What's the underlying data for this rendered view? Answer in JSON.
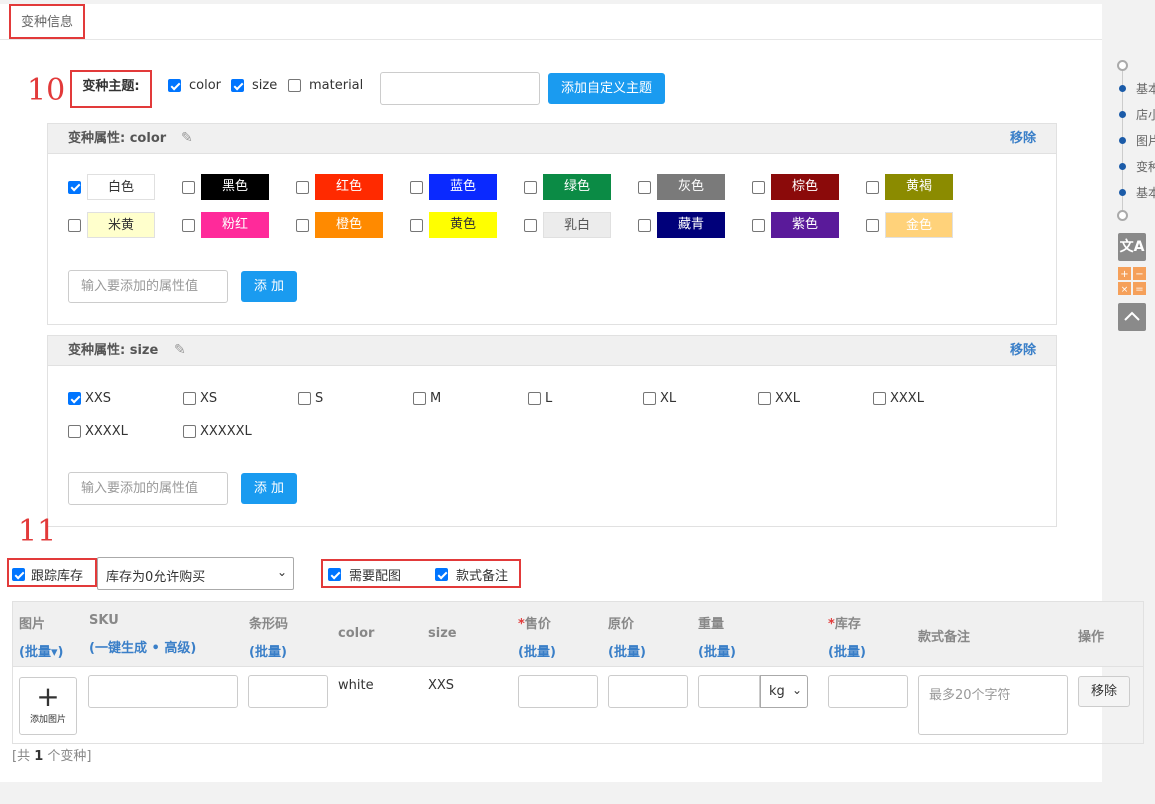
{
  "panel": {
    "title": "变种信息"
  },
  "annotations": {
    "step10": "10",
    "step11": "11"
  },
  "theme": {
    "label": "变种主题:",
    "options": [
      {
        "label": "color",
        "checked": true
      },
      {
        "label": "size",
        "checked": true
      },
      {
        "label": "material",
        "checked": false
      }
    ],
    "custom_input_value": "",
    "add_custom_button": "添加自定义主题"
  },
  "color_attr": {
    "title": "变种属性:  color",
    "remove": "移除",
    "items": [
      {
        "label": "白色",
        "checked": true,
        "bg": "#ffffff",
        "fg": "#333333"
      },
      {
        "label": "黑色",
        "checked": false,
        "bg": "#000000",
        "fg": "#ffffff"
      },
      {
        "label": "红色",
        "checked": false,
        "bg": "#ff2a00",
        "fg": "#ffffff"
      },
      {
        "label": "蓝色",
        "checked": false,
        "bg": "#0a29ff",
        "fg": "#ffffff"
      },
      {
        "label": "绿色",
        "checked": false,
        "bg": "#0b8b45",
        "fg": "#ffffff"
      },
      {
        "label": "灰色",
        "checked": false,
        "bg": "#7a7a7a",
        "fg": "#ffffff"
      },
      {
        "label": "棕色",
        "checked": false,
        "bg": "#8b0a0a",
        "fg": "#ffffff"
      },
      {
        "label": "黄褐",
        "checked": false,
        "bg": "#8b8b00",
        "fg": "#ffffff"
      },
      {
        "label": "米黄",
        "checked": false,
        "bg": "#ffffcc",
        "fg": "#333333"
      },
      {
        "label": "粉红",
        "checked": false,
        "bg": "#ff2a9a",
        "fg": "#ffffff"
      },
      {
        "label": "橙色",
        "checked": false,
        "bg": "#ff8a00",
        "fg": "#ffffff"
      },
      {
        "label": "黄色",
        "checked": false,
        "bg": "#ffff00",
        "fg": "#333333"
      },
      {
        "label": "乳白",
        "checked": false,
        "bg": "#ececec",
        "fg": "#555555"
      },
      {
        "label": "藏青",
        "checked": false,
        "bg": "#00007a",
        "fg": "#ffffff"
      },
      {
        "label": "紫色",
        "checked": false,
        "bg": "#5a1a9a",
        "fg": "#ffffff"
      },
      {
        "label": "金色",
        "checked": false,
        "bg": "#ffd27a",
        "fg": "#ffffff"
      }
    ],
    "input_placeholder": "输入要添加的属性值",
    "add_button": "添 加"
  },
  "size_attr": {
    "title": "变种属性:  size",
    "remove": "移除",
    "items": [
      {
        "label": "XXS",
        "checked": true
      },
      {
        "label": "XS",
        "checked": false
      },
      {
        "label": "S",
        "checked": false
      },
      {
        "label": "M",
        "checked": false
      },
      {
        "label": "L",
        "checked": false
      },
      {
        "label": "XL",
        "checked": false
      },
      {
        "label": "XXL",
        "checked": false
      },
      {
        "label": "XXXL",
        "checked": false
      },
      {
        "label": "XXXXL",
        "checked": false
      },
      {
        "label": "XXXXXL",
        "checked": false
      }
    ],
    "input_placeholder": "输入要添加的属性值",
    "add_button": "添 加"
  },
  "inventory": {
    "track_label": "跟踪库存",
    "track_checked": true,
    "policy_selected": "库存为0允许购买",
    "need_image_label": "需要配图",
    "need_image_checked": true,
    "style_note_label": "款式备注",
    "style_note_checked": true
  },
  "table": {
    "headers": {
      "image": "图片",
      "image_sub": "(批量▾)",
      "sku": "SKU",
      "sku_sub_open": "(",
      "sku_gen": "一键生成",
      "sku_dot": " • ",
      "sku_adv": "高级",
      "sku_sub_close": ")",
      "barcode": "条形码",
      "barcode_sub": "(批量)",
      "color": "color",
      "size": "size",
      "price_star": "*",
      "price": "售价",
      "price_sub": "(批量)",
      "orig": "原价",
      "orig_sub": "(批量)",
      "weight": "重量",
      "weight_sub": "(批量)",
      "stock_star": "*",
      "stock": "库存",
      "stock_sub": "(批量)",
      "note": "款式备注",
      "action": "操作"
    },
    "row": {
      "add_image": "添加图片",
      "color": "white",
      "size": "XXS",
      "weight_unit": "kg",
      "note_placeholder": "最多20个字符",
      "remove": "移除"
    },
    "footer_prefix": "[共 ",
    "footer_count": "1",
    "footer_suffix": " 个变种]"
  },
  "sidebar": {
    "items": [
      "基本",
      "店小",
      "图片",
      "变种",
      "基本"
    ],
    "tool_icons": [
      "translate-icon",
      "calculator-icon",
      "back-to-top-icon"
    ]
  }
}
